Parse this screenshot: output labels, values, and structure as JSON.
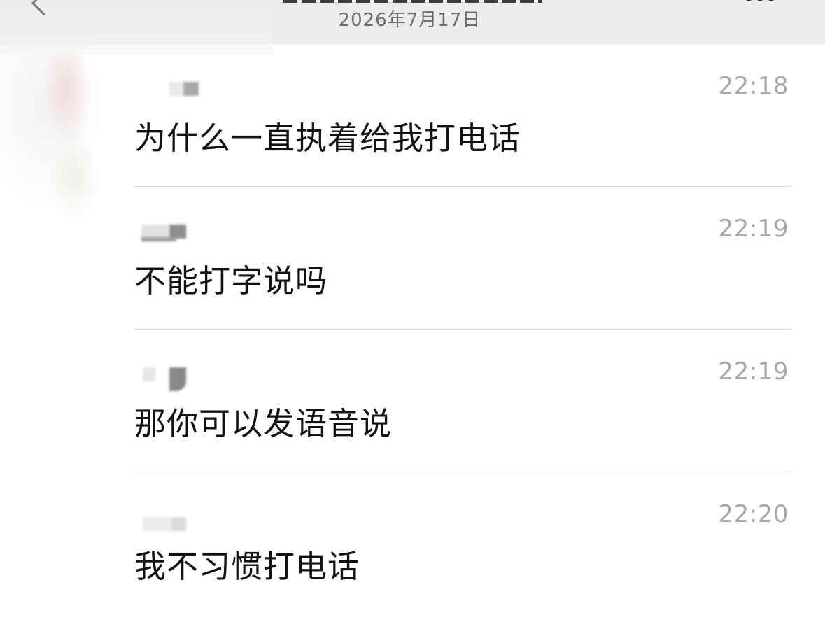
{
  "header": {
    "date": "2026年7月17日"
  },
  "messages": [
    {
      "time": "22:18",
      "text": "为什么一直执着给我打电话"
    },
    {
      "time": "22:19",
      "text": "不能打字说吗"
    },
    {
      "time": "22:19",
      "text": "那你可以发语音说"
    },
    {
      "time": "22:20",
      "text": "我不习惯打电话"
    }
  ],
  "icons": {
    "back": "chevron-left-icon",
    "more": "more-dots-icon"
  }
}
